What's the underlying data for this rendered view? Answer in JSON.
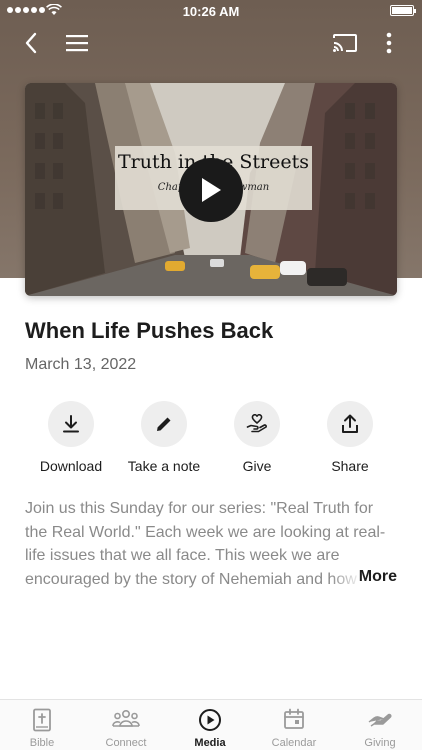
{
  "status_bar": {
    "time": "10:26 AM"
  },
  "nav": {
    "back_icon": "back-arrow-icon",
    "menu_icon": "hamburger-menu-icon",
    "cast_icon": "cast-icon",
    "more_icon": "more-vertical-icon"
  },
  "video": {
    "title_line1": "Truth in the Streets",
    "title_line2": "Chaplain ... Bouwman",
    "play_icon": "play-icon"
  },
  "sermon": {
    "title": "When Life Pushes Back",
    "date": "March 13, 2022"
  },
  "actions": [
    {
      "label": "Download",
      "icon": "download-icon"
    },
    {
      "label": "Take a note",
      "icon": "pencil-icon"
    },
    {
      "label": "Give",
      "icon": "heart-hand-icon"
    },
    {
      "label": "Share",
      "icon": "share-icon"
    }
  ],
  "description": {
    "text": "Join us this Sunday for our series: \"Real Truth for the Real World.\" Each week we are looking at real-life issues that we all face. This week we are encouraged by the story of Nehemiah and how",
    "more_label": "More"
  },
  "tabs": [
    {
      "label": "Bible",
      "icon": "bible-icon",
      "active": false
    },
    {
      "label": "Connect",
      "icon": "people-icon",
      "active": false
    },
    {
      "label": "Media",
      "icon": "play-circle-icon",
      "active": true
    },
    {
      "label": "Calendar",
      "icon": "calendar-icon",
      "active": false
    },
    {
      "label": "Giving",
      "icon": "giving-hand-icon",
      "active": false
    }
  ],
  "colors": {
    "header_bg": "#7b6a5d",
    "accent": "#1d1d1d",
    "muted_text": "#8a8a8a"
  }
}
